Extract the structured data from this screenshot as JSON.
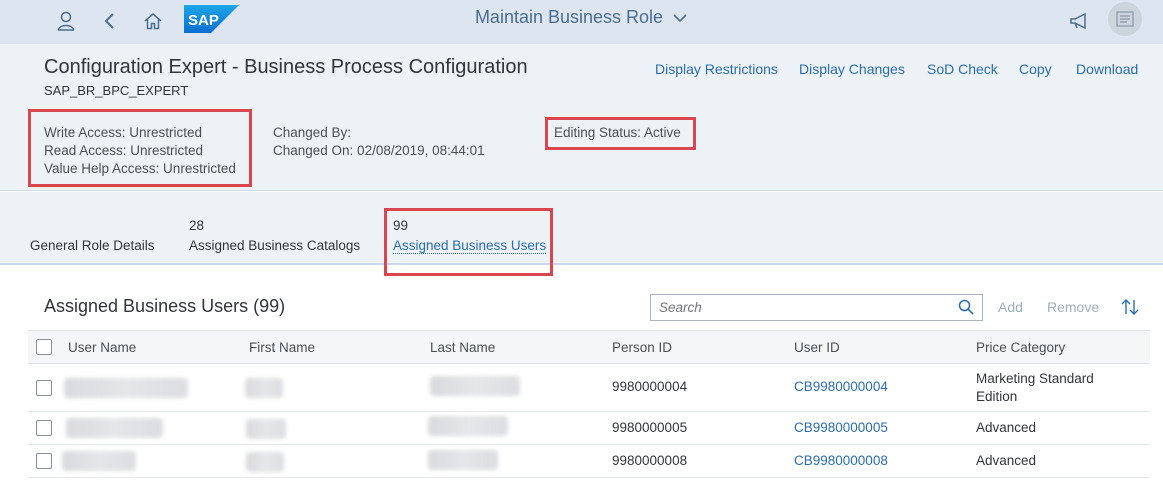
{
  "shell": {
    "title": "Maintain Business Role",
    "logo_text": "SAP"
  },
  "header": {
    "title": "Configuration Expert - Business Process Configuration",
    "subtitle": "SAP_BR_BPC_EXPERT",
    "actions": [
      "Display Restrictions",
      "Display Changes",
      "SoD Check",
      "Copy",
      "Download"
    ],
    "access": [
      "Write Access: Unrestricted",
      "Read Access: Unrestricted",
      "Value Help Access: Unrestricted"
    ],
    "changed_by": "Changed By:",
    "changed_on": "Changed On: 02/08/2019, 08:44:01",
    "editing_status": "Editing Status: Active"
  },
  "tabs": [
    {
      "count": "",
      "label": "General Role Details"
    },
    {
      "count": "28",
      "label": "Assigned Business Catalogs"
    },
    {
      "count": "99",
      "label": "Assigned Business Users"
    }
  ],
  "table": {
    "title": "Assigned Business Users (99)",
    "search_placeholder": "Search",
    "add_label": "Add",
    "remove_label": "Remove",
    "columns": [
      "User Name",
      "First Name",
      "Last Name",
      "Person ID",
      "User ID",
      "Price Category"
    ],
    "rows": [
      {
        "person_id": "9980000004",
        "user_id": "CB9980000004",
        "price_category": "Marketing Standard Edition"
      },
      {
        "person_id": "9980000005",
        "user_id": "CB9980000005",
        "price_category": "Advanced"
      },
      {
        "person_id": "9980000008",
        "user_id": "CB9980000008",
        "price_category": "Advanced"
      }
    ]
  },
  "colors": {
    "shell_bg": "#dde6f0",
    "header_bg": "#edf2f7",
    "link": "#2b6db0",
    "highlight": "#d9464f"
  },
  "icons": [
    "user-icon",
    "back-icon",
    "home-icon",
    "chevron-down-icon",
    "megaphone-icon",
    "menu-icon",
    "search-icon",
    "sort-icon"
  ]
}
